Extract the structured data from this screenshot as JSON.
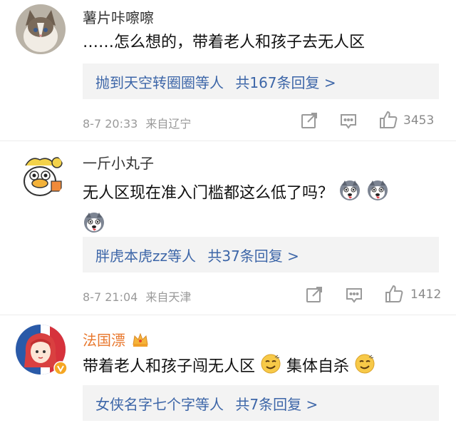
{
  "comments": [
    {
      "username": "薯片咔嚓嚓",
      "text": "……怎么想的，带着老人和孩子去无人区",
      "reply_users": "抛到天空转圈圈等人",
      "reply_count": "共167条回复 >",
      "time": "8-7 20:33",
      "location": "来自辽宁",
      "likes": "3453"
    },
    {
      "username": "一斤小丸子",
      "text": "无人区现在准入门槛都这么低了吗？",
      "reply_users": "胖虎本虎zz等人",
      "reply_count": "共37条回复 >",
      "time": "8-7 21:04",
      "location": "来自天津",
      "likes": "1412"
    },
    {
      "username": "法国漂",
      "text_part1": "带着老人和孩子闯无人区",
      "text_part2": "集体自杀",
      "reply_users": "女侠名字七个字等人",
      "reply_count": "共7条回复 >"
    }
  ],
  "icons": {
    "share": "share-icon",
    "comment": "comment-icon",
    "like": "thumbs-up-icon",
    "vip": "crown-icon",
    "verified": "verified-badge-icon"
  },
  "colors": {
    "reply_link": "#3d66a8",
    "vip_name": "#e8762b",
    "meta_gray": "#9a9a9a"
  }
}
